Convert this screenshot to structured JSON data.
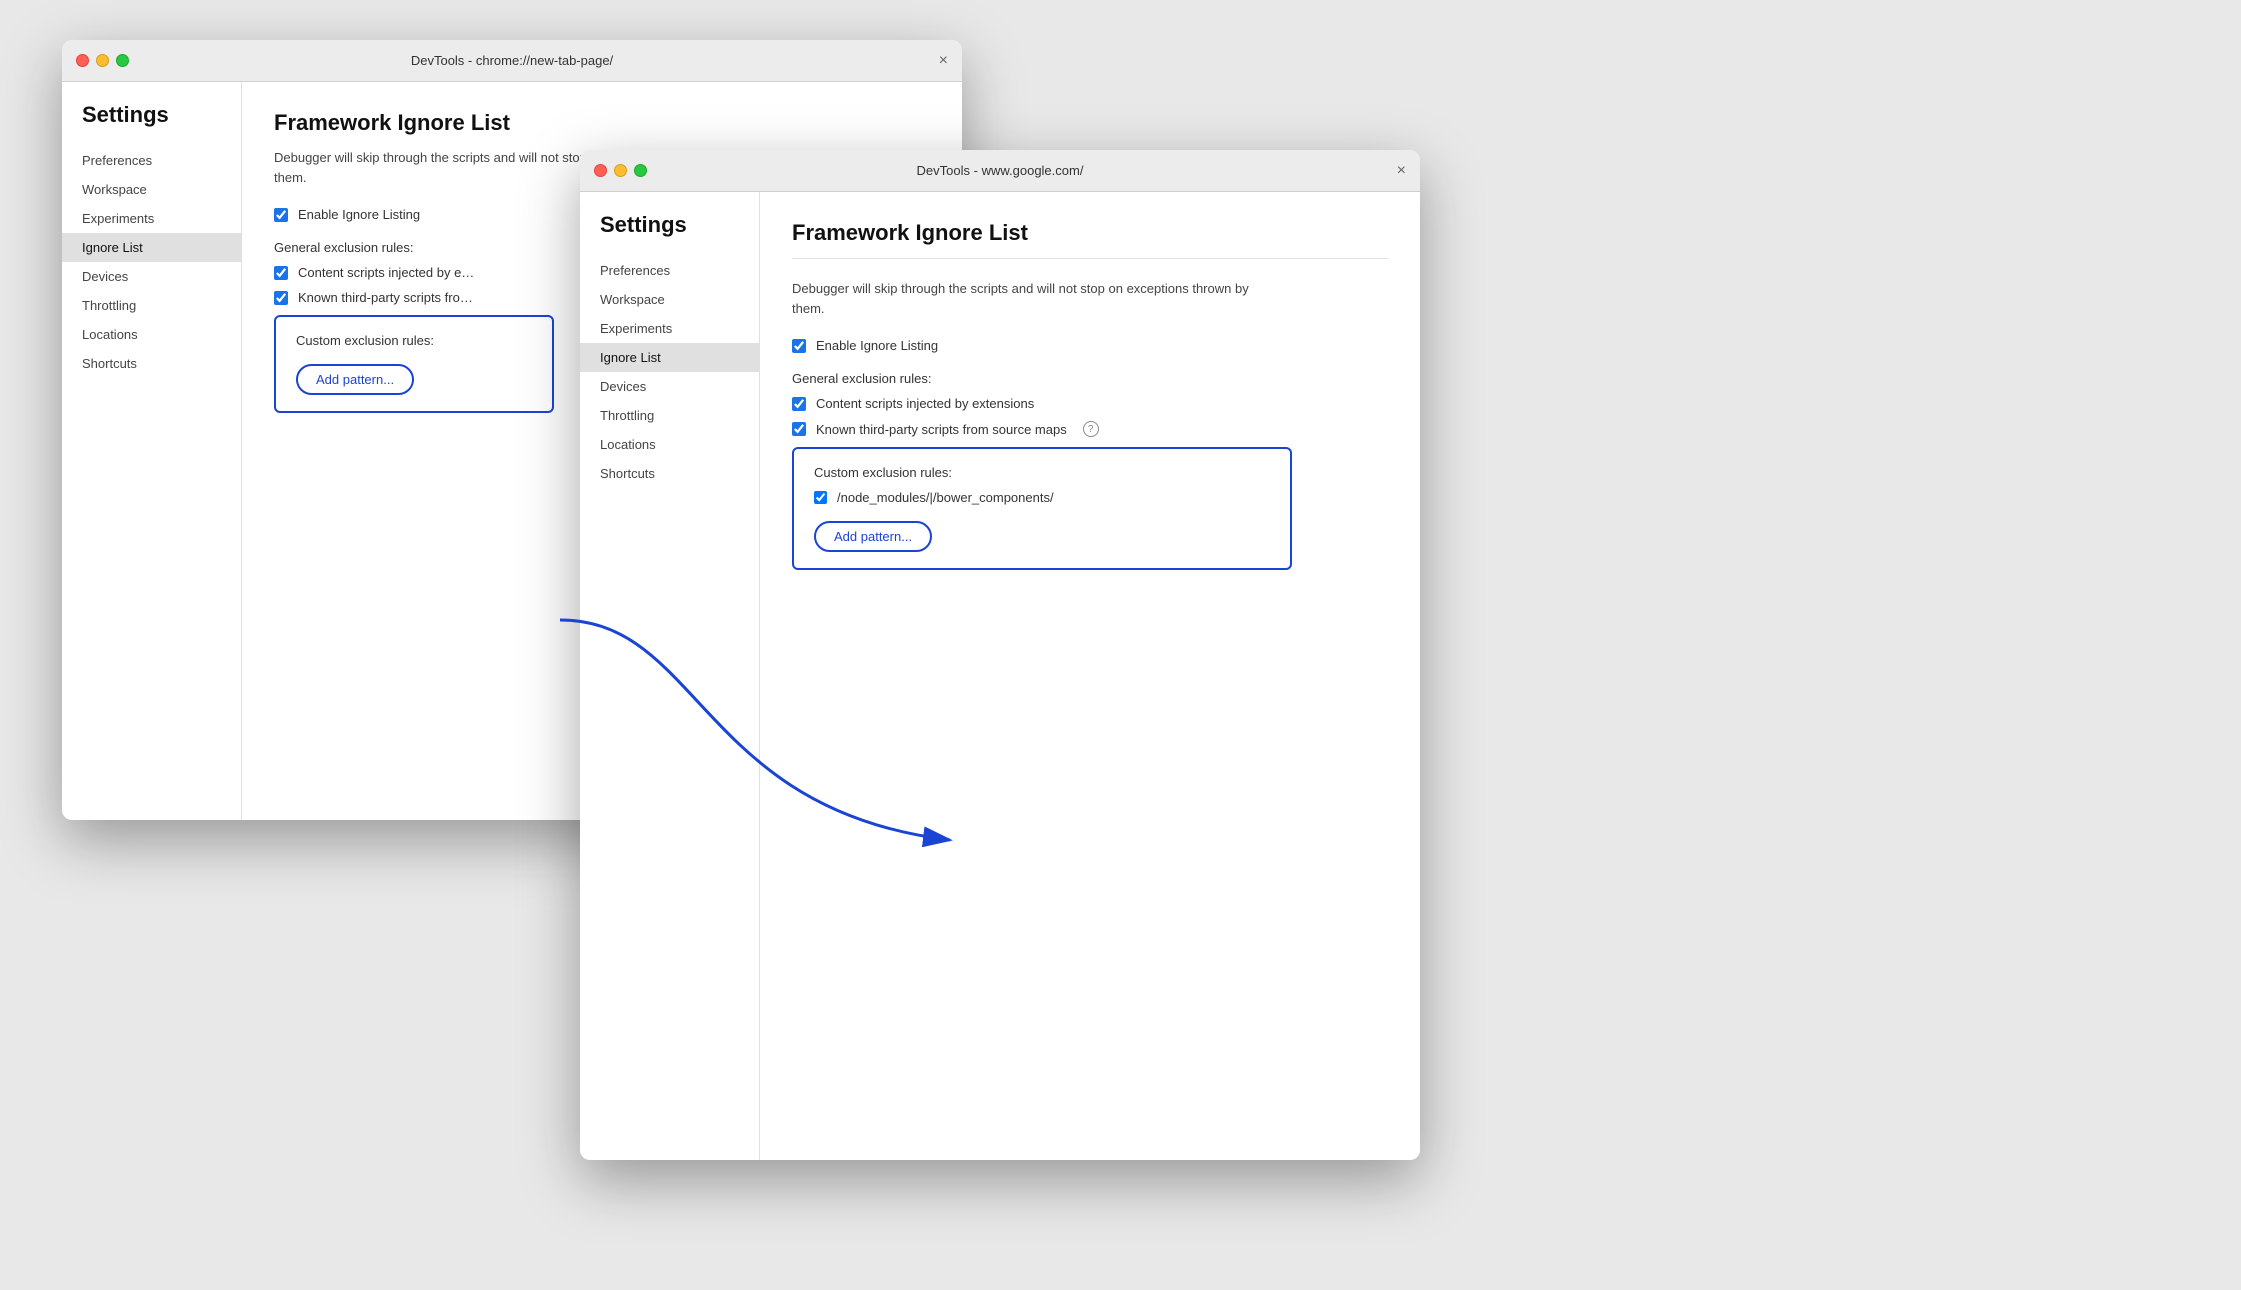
{
  "window1": {
    "titlebar": "DevTools - chrome://new-tab-page/",
    "close_label": "×",
    "settings_heading": "Settings",
    "sidebar_items": [
      {
        "label": "Preferences",
        "active": false
      },
      {
        "label": "Workspace",
        "active": false
      },
      {
        "label": "Experiments",
        "active": false
      },
      {
        "label": "Ignore List",
        "active": true
      },
      {
        "label": "Devices",
        "active": false
      },
      {
        "label": "Throttling",
        "active": false
      },
      {
        "label": "Locations",
        "active": false
      },
      {
        "label": "Shortcuts",
        "active": false
      }
    ],
    "content_title": "Framework Ignore List",
    "content_desc": "Debugger will skip through the scripts and will not stop on exceptions thrown by them.",
    "enable_label": "Enable Ignore Listing",
    "general_label": "General exclusion rules:",
    "rule1": "Content scripts injected by e…",
    "rule2": "Known third-party scripts fro…",
    "custom_label": "Custom exclusion rules:",
    "add_pattern": "Add pattern..."
  },
  "window2": {
    "titlebar": "DevTools - www.google.com/",
    "close_label": "×",
    "settings_heading": "Settings",
    "sidebar_items": [
      {
        "label": "Preferences",
        "active": false
      },
      {
        "label": "Workspace",
        "active": false
      },
      {
        "label": "Experiments",
        "active": false
      },
      {
        "label": "Ignore List",
        "active": true
      },
      {
        "label": "Devices",
        "active": false
      },
      {
        "label": "Throttling",
        "active": false
      },
      {
        "label": "Locations",
        "active": false
      },
      {
        "label": "Shortcuts",
        "active": false
      }
    ],
    "content_title": "Framework Ignore List",
    "content_desc": "Debugger will skip through the scripts and will not stop on exceptions thrown by them.",
    "enable_label": "Enable Ignore Listing",
    "general_label": "General exclusion rules:",
    "rule1": "Content scripts injected by extensions",
    "rule2": "Known third-party scripts from source maps",
    "custom_label": "Custom exclusion rules:",
    "custom_rule_value": "/node_modules/|/bower_components/",
    "add_pattern": "Add pattern...",
    "help_icon": "?"
  }
}
